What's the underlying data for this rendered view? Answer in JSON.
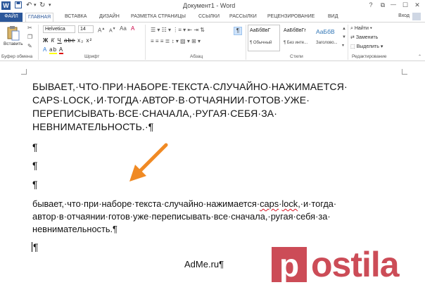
{
  "titlebar": {
    "logo": "W",
    "doc_title": "Документ1 - Word",
    "help": "?",
    "restore": "⧉",
    "minimize": "—",
    "maximize": "☐",
    "close": "✕"
  },
  "tabs": {
    "file": "ФАЙЛ",
    "items": [
      "ГЛАВНАЯ",
      "ВСТАВКА",
      "ДИЗАЙН",
      "РАЗМЕТКА СТРАНИЦЫ",
      "ССЫЛКИ",
      "РАССЫЛКИ",
      "РЕЦЕНЗИРОВАНИЕ",
      "ВИД"
    ],
    "login": "Вход"
  },
  "ribbon": {
    "paste_label": "Вставить",
    "font_name": "Helvetica",
    "font_size": "14",
    "bold": "Ж",
    "italic": "К",
    "underline": "Ч",
    "pilcrow": "¶",
    "styles": [
      {
        "preview": "АаБбВвГ",
        "name": "¶ Обычный"
      },
      {
        "preview": "АаБбВвГг",
        "name": "¶ Без инте..."
      },
      {
        "preview": "АаБбВ",
        "name": "Заголово..."
      }
    ],
    "find": "Найти",
    "replace": "Заменить",
    "select": "Выделить",
    "groups": {
      "clipboard": "Буфер обмена",
      "font": "Шрифт",
      "paragraph": "Абзац",
      "styles": "Стили",
      "editing": "Редактирование"
    }
  },
  "document": {
    "upper_lines": [
      "БЫВАЕТ,·ЧТО·ПРИ·НАБОРЕ·ТЕКСТА·СЛУЧАЙНО·НАЖИМАЕТСЯ·",
      "CAPS·LOCK,·И·ТОГДА·АВТОР·В·ОТЧАЯНИИ·ГОТОВ·УЖЕ·",
      "ПЕРЕПИСЫВАТЬ·ВСЕ·СНАЧАЛА,·РУГАЯ·СЕБЯ·ЗА·",
      "НЕВНИМАТЕЛЬНОСТЬ.·¶"
    ],
    "empty_paragraphs": [
      "¶",
      "¶",
      "¶"
    ],
    "lower_line1_a": "бывает,·что·при·наборе·текста·случайно·нажимается·",
    "lower_line1_caps": "caps",
    "lower_line1_mid": "·",
    "lower_line1_lock": "lock",
    "lower_line1_b": ",·и·тогда·",
    "lower_line2": "автор·в·отчаянии·готов·уже·переписывать·все·сначала,·ругая·себя·за·",
    "lower_line3": "невнимательность.¶",
    "last_mark": "¶",
    "adme": "AdMe.ru¶"
  },
  "colors": {
    "word_blue": "#2b579a",
    "arrow": "#f08a24",
    "watermark": "#be1928"
  },
  "watermark": "postila.ru"
}
